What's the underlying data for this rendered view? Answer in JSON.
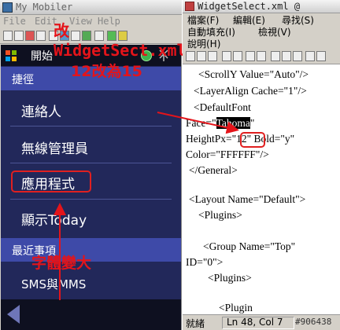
{
  "left_window": {
    "title": "My Mobiler",
    "menu": [
      "File",
      "Edit",
      "View",
      "Help"
    ]
  },
  "phone": {
    "start_label": "開始",
    "sections": [
      {
        "header": "捷徑",
        "items": [
          "連絡人",
          "無線管理員",
          "應用程式",
          "顯示Today"
        ]
      },
      {
        "header": "最近事項",
        "items": [
          "SMS與MMS"
        ]
      }
    ]
  },
  "annotations": {
    "edit_file": "改WidgetSect.xml",
    "change_size": "12改為15",
    "font_bigger": "字體變大"
  },
  "right_window": {
    "title": "WidgetSelect.xml @",
    "menu_row1": [
      "檔案(F)",
      "編輯(E)",
      "尋找(S)"
    ],
    "menu_row2": [
      "自動填充(I)",
      "檢視(V)"
    ],
    "menu_row3": [
      "說明(H)"
    ],
    "code": {
      "l1": "<ScrollY Value=\"Auto\"/>",
      "l2": "<LayerAlign Cache=\"1\"/>",
      "l3": "<DefaultFont",
      "l4a": "Face=\"",
      "l4b": "Tahoma",
      "l4c": "\"",
      "l5a": "HeightPx=\"",
      "l5b": "12",
      "l5c": "\" Bold=\"y\"",
      "l6": "Color=\"FFFFFF\"/>",
      "l7": "</General>",
      "l8": "<Layout Name=\"Default\">",
      "l9": "<Plugins>",
      "l10": "<Group Name=\"Top\"",
      "l11": "ID=\"0\">",
      "l12": "<Plugins>",
      "l13": "<Plugin"
    },
    "status": {
      "ready": "就緒",
      "position": "Ln 48, Col 7"
    },
    "watermark": "#906438"
  },
  "colors": {
    "phone_bg": "#22285a",
    "phone_header": "#3e4aa8",
    "annotation": "#e4141a"
  }
}
